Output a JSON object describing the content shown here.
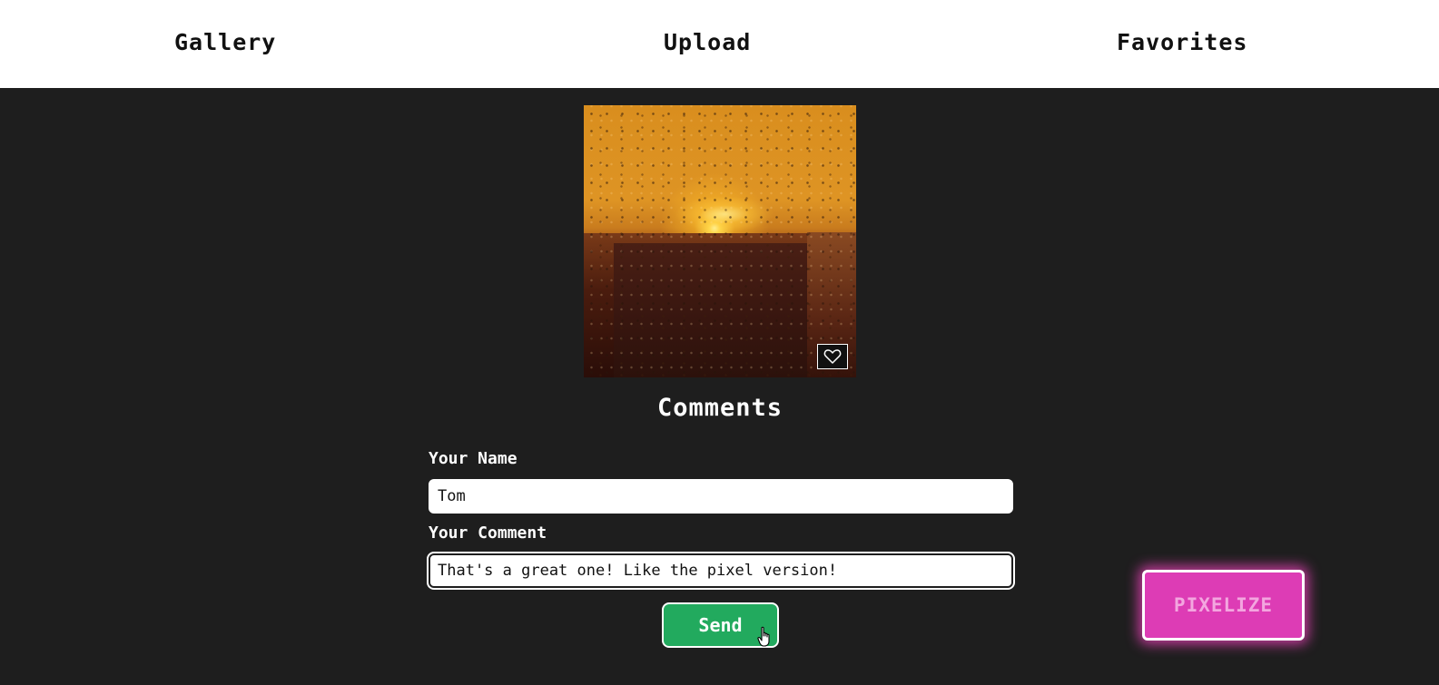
{
  "nav": {
    "items": [
      {
        "label": "Gallery"
      },
      {
        "label": "Upload"
      },
      {
        "label": "Favorites"
      }
    ]
  },
  "photo": {
    "favorite_icon": "heart-outline-icon"
  },
  "comments": {
    "title": "Comments",
    "name_label": "Your Name",
    "name_value": "Tom",
    "comment_label": "Your Comment",
    "comment_value": "That's a great one! Like the pixel version!",
    "send_label": "Send"
  },
  "pixelize": {
    "label": "PIXELIZE"
  },
  "colors": {
    "background": "#1e1e1e",
    "nav_background": "#ffffff",
    "send_button": "#22aa5e",
    "pixelize_button": "#dd3cb5",
    "pixelize_glow": "#ff46c8"
  }
}
